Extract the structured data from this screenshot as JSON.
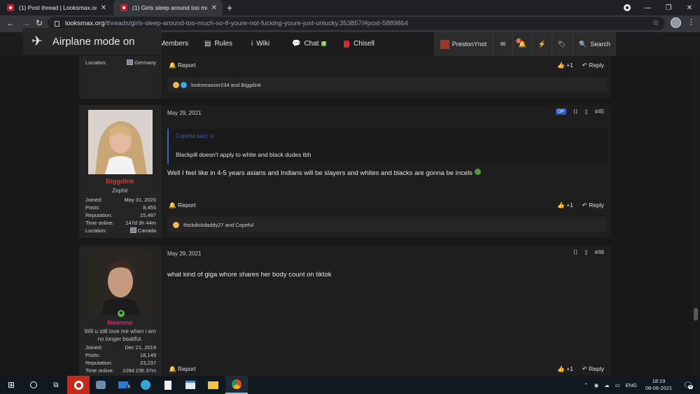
{
  "browser": {
    "tabs": [
      {
        "title": "(1) Post thread | Looksmax.org - S",
        "active": false
      },
      {
        "title": "(1) Girls sleep around too much...",
        "active": true
      }
    ],
    "url_domain": "looksmax.org",
    "url_path": "/threads/girls-sleep-around-too-much-so-if-youre-not-fucking-youre-just-unlucky.353857/#post-5889864"
  },
  "overlay": {
    "airplane_text": "Airplane mode on"
  },
  "site_nav": {
    "members": "Members",
    "rules": "Rules",
    "wiki": "Wiki",
    "chat": "Chat",
    "chat_count": "4",
    "chisell": "Chisell",
    "username": "PrestonYnot",
    "alert_count": "1",
    "search": "Search"
  },
  "posts": [
    {
      "location_label": "Location:",
      "location": "Germany",
      "report": "Report",
      "plus": "+1",
      "reply": "Reply",
      "reactions": "looksmaxxer234 and Biggdink"
    },
    {
      "date": "May 29, 2021",
      "op_badge": "OP",
      "number": "#45",
      "username": "Biggdink",
      "user_title": "Zephir",
      "stats": [
        {
          "label": "Joined:",
          "value": "May 31, 2020"
        },
        {
          "label": "Posts:",
          "value": "8,455"
        },
        {
          "label": "Reputation:",
          "value": "15,487"
        },
        {
          "label": "Time online:",
          "value": "147d 3h 44m"
        },
        {
          "label": "Location:",
          "value": "Canada"
        }
      ],
      "quote_author": "Copeful said:",
      "quote_text": "Blackpill doesn't apply to white and black dudes tbh",
      "text": "Well I feel like in 4-5 years asians and Indians will be slayers and whites and blacks are gonna be incels",
      "report": "Report",
      "plus": "+1",
      "reply": "Reply",
      "reactions": "thickdickdaddy27 and Copeful"
    },
    {
      "date": "May 29, 2021",
      "number": "#46",
      "username": "Newone",
      "user_title": "Will u still love me when i am no longer beatiful.",
      "stats": [
        {
          "label": "Joined:",
          "value": "Dec 21, 2019"
        },
        {
          "label": "Posts:",
          "value": "18,149"
        },
        {
          "label": "Reputation:",
          "value": "23,237"
        },
        {
          "label": "Time online:",
          "value": "109d 23h 37m"
        }
      ],
      "text": "what kind of giga whore shares her body count on tiktok",
      "report": "Report",
      "plus": "+1",
      "reply": "Reply"
    }
  ],
  "taskbar": {
    "lang": "ENG",
    "time": "18:19",
    "date": "08-06-2021",
    "mail_badge": "4",
    "notif_badge": "6"
  },
  "colors": {
    "username_red": "#e0332f",
    "username_pink": "#e0246a",
    "accent_blue": "#2f5ed0"
  }
}
